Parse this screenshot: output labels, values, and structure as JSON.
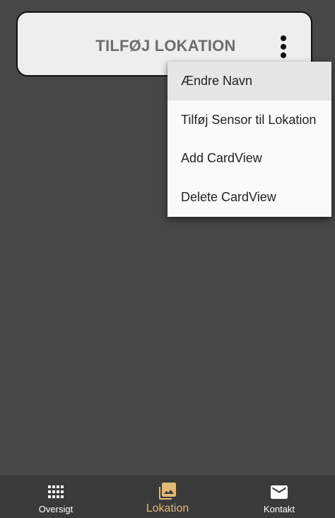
{
  "card": {
    "title": "TILFØJ LOKATION"
  },
  "menu": {
    "items": [
      {
        "label": "Ændre Navn"
      },
      {
        "label": "Tilføj Sensor til Lokation"
      },
      {
        "label": "Add CardView"
      },
      {
        "label": "Delete CardView"
      }
    ]
  },
  "bottom_nav": {
    "items": [
      {
        "label": "Oversigt",
        "icon": "grid-icon"
      },
      {
        "label": "Lokation",
        "icon": "photo-library-icon",
        "active": true
      },
      {
        "label": "Kontakt",
        "icon": "mail-icon"
      }
    ]
  },
  "colors": {
    "background": "#474747",
    "card": "#eeeeee",
    "active_accent": "#e2b975",
    "nav_background": "#3a3a3a",
    "menu_background": "#fafafa"
  }
}
